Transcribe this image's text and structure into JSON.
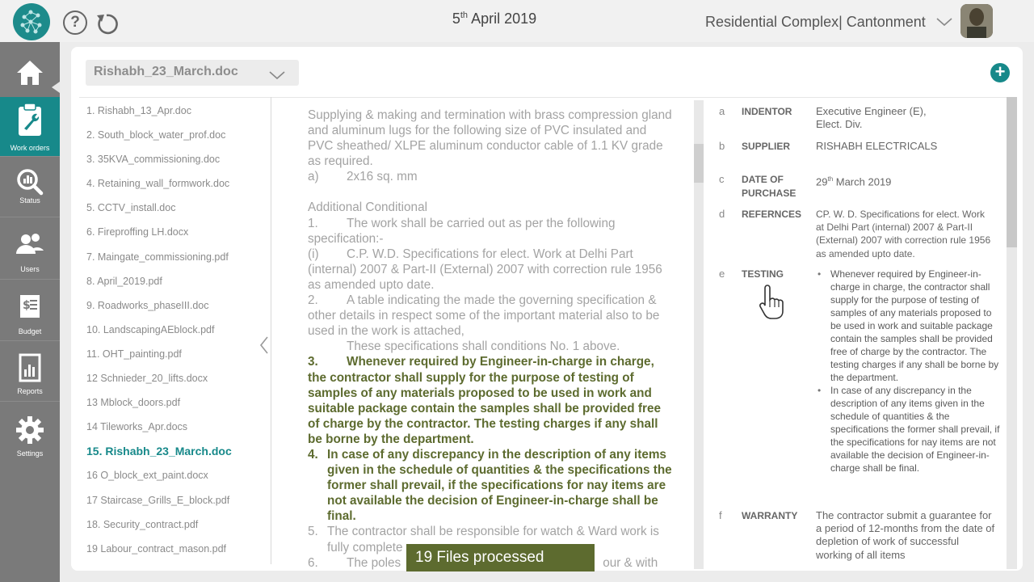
{
  "header": {
    "date_day": "5",
    "date_suffix": "th",
    "date_rest": " April 2019",
    "project": "Residential Complex| Cantonment"
  },
  "sidebar": {
    "items": [
      {
        "label": "",
        "icon": "home-icon"
      },
      {
        "label": "Work orders",
        "icon": "clipboard-wrench-icon"
      },
      {
        "label": "Status",
        "icon": "status-icon"
      },
      {
        "label": "Users",
        "icon": "users-icon"
      },
      {
        "label": "Budget",
        "icon": "budget-icon"
      },
      {
        "label": "Reports",
        "icon": "reports-icon"
      },
      {
        "label": "Settings",
        "icon": "gear-icon"
      }
    ]
  },
  "document_selector": {
    "value": "Rishabh_23_March.doc"
  },
  "files": [
    "1. Rishabh_13_Apr.doc",
    "2. South_block_water_prof.doc",
    "3. 35KVA_commissioning.doc",
    "4. Retaining_wall_formwork.doc",
    "5. CCTV_install.doc",
    "6. Fireproffing  LH.docx",
    "7. Maingate_commissioning.pdf",
    "8. April_2019.pdf",
    "9. Roadworks_phaseIII.doc",
    "10. LandscapingAEblock.pdf",
    "11. OHT_painting.pdf",
    "12 Schnieder_20_lifts.docx",
    "13 Mblock_doors.pdf",
    "14 Tileworks_Apr.docs",
    "15. Rishabh_23_March.doc",
    "16 O_block_ext_paint.docx",
    "17 Staircase_Grills_E_block.pdf",
    "18. Security_contract.pdf",
    "19 Labour_contract_mason.pdf"
  ],
  "active_file_index": 14,
  "document": {
    "intro": "Supplying & making and termination with  brass compression gland and aluminum  lugs for the following  size of PVC insulated and PVC sheathed/ XLPE aluminum  conductor cable of 1.1 KV grade as required.",
    "intro_a_label": "a)",
    "intro_a_text": "2x16 sq. mm",
    "heading": "Additional Conditional",
    "p1_num": "1.",
    "p1": "The work shall be carried out as per the following specification:-",
    "pi_num": "(i)",
    "pi": "C.P. W.D. Specifications for  elect. Work at Delhi Part (internal) 2007 & Part-II  (External)  2007 with correction rule 1956 as amended upto date.",
    "p2_num": "2.",
    "p2": "A table indicating the made the governing specification & other details in respect some  of the important  material also to be used in the work is attached,",
    "p2b": "These specifications shall conditions No. 1 above.",
    "p3_num": "3.",
    "p3": "Whenever required by Engineer-in-charge in charge, the contractor shall supply for the purpose of testing of samples of any materials proposed to be used in work and suitable package contain the samples shall be provided free of charge by the contractor. The testing charges if any shall be borne by the department.",
    "p4_num": "4.",
    "p4": "In case of any discrepancy in the  description of any items given  in the schedule of quantities & the specifications the former shall prevail, if the specifications for nay items are not available the decision of Engineer-in-charge shall be final.",
    "p5_num": "5.",
    "p5": "The contractor shall be responsible for watch & Ward work is fully  complete",
    "p6_num": "6.",
    "p6": "The poles",
    "p6_tail": "our & with"
  },
  "details": {
    "indentor": {
      "letter": "a",
      "key": "INDENTOR",
      "value": "Executive Engineer (E), Elect. Div."
    },
    "supplier": {
      "letter": "b",
      "key": "SUPPLIER",
      "value": "RISHABH  ELECTRICALS"
    },
    "purchase": {
      "letter": "c",
      "key": "DATE OF PURCHASE",
      "day": "29",
      "suffix": "th",
      "rest": " March 2019"
    },
    "refs": {
      "letter": "d",
      "key": "REFERNCES",
      "value": "CP. W. D. Specifications for  elect. Work at Delhi Part (internal)  2007 & Part-II (External) 2007 with correction rule 1956 as amended upto date."
    },
    "testing": {
      "letter": "e",
      "key": "TESTING",
      "bullets": [
        "Whenever required by Engineer-in-charge in charge, the contractor shall supply for the purpose of testing of samples of any materials proposed to be used in work and suitable package contain the samples shall be provided  free of charge by the contractor. The testing charges if any shall be borne by the department.",
        "In case of any discrepancy in the description of any items given   in the schedule of quantities & the specifications the former  shall prevail,  if the specifications for nay items are not available the decision of Engineer-in-charge  shall be final."
      ]
    },
    "warranty": {
      "letter": "f",
      "key": "WARRANTY",
      "value": "The contractor submit a guarantee for a period of 12-months from the date of depletion of work of successful working of all items"
    }
  },
  "toast": {
    "text": "19 Files processed"
  },
  "colors": {
    "accent": "#17898a",
    "sidebar": "#7a7a7a",
    "highlight_text": "#5d6b2f"
  }
}
